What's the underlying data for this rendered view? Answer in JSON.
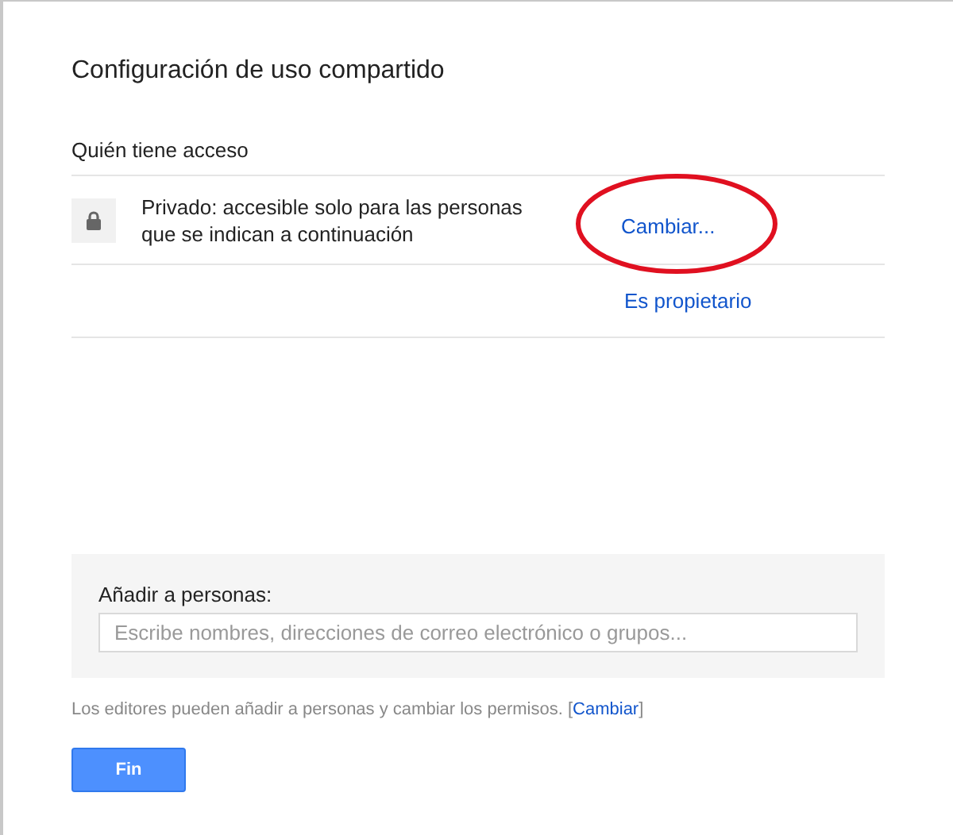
{
  "dialog": {
    "title": "Configuración de uso compartido"
  },
  "access": {
    "heading": "Quién tiene acceso",
    "rows": [
      {
        "kind": "visibility",
        "text": "Privado: accesible solo para las personas que se indican a continuación",
        "action": "Cambiar...",
        "highlighted": true
      },
      {
        "kind": "owner",
        "action": "Es propietario",
        "highlighted": false
      }
    ]
  },
  "add_people": {
    "label": "Añadir a personas:",
    "placeholder": "Escribe nombres, direcciones de correo electrónico o grupos..."
  },
  "note": {
    "text": "Los editores pueden añadir a personas y cambiar los permisos.",
    "link_prefix": "[",
    "link": "Cambiar",
    "link_suffix": "]"
  },
  "buttons": [
    {
      "label": "Fin"
    }
  ]
}
